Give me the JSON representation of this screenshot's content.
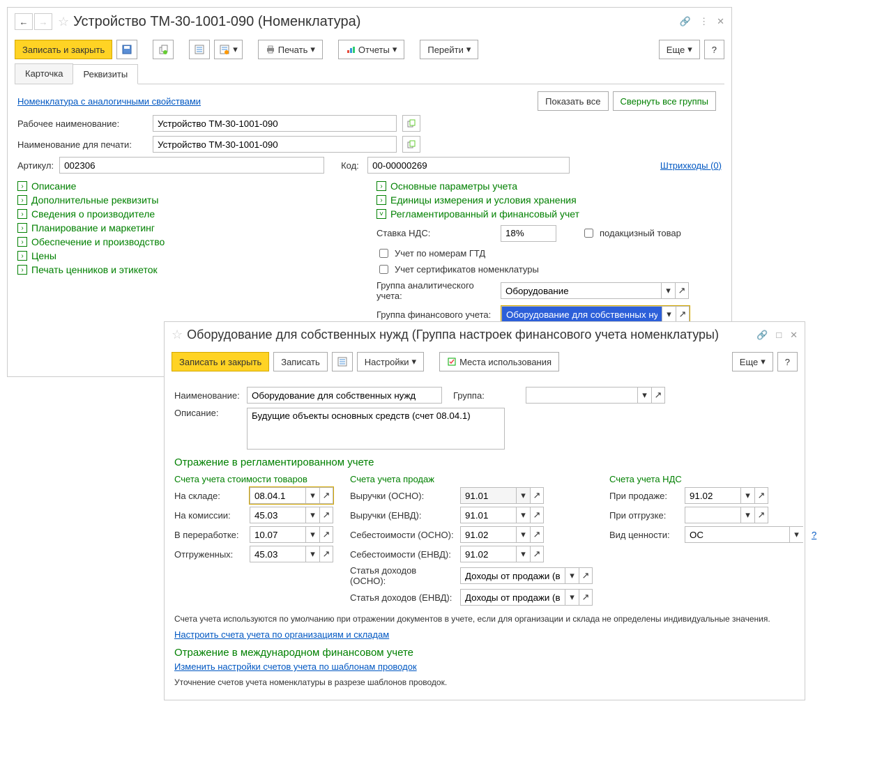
{
  "win1": {
    "title": "Устройство ТМ-30-1001-090 (Номенклатура)",
    "toolbar": {
      "saveAndClose": "Записать и закрыть",
      "print": "Печать",
      "reports": "Отчеты",
      "goto": "Перейти",
      "more": "Еще",
      "help": "?"
    },
    "tabs": {
      "card": "Карточка",
      "details": "Реквизиты"
    },
    "linkSimilar": "Номенклатура с аналогичными свойствами",
    "showAll": "Показать все",
    "collapseAll": "Свернуть все группы",
    "fields": {
      "workName": {
        "label": "Рабочее наименование:",
        "value": "Устройство ТМ-30-1001-090"
      },
      "printName": {
        "label": "Наименование для печати:",
        "value": "Устройство ТМ-30-1001-090"
      },
      "article": {
        "label": "Артикул:",
        "value": "002306"
      },
      "code": {
        "label": "Код:",
        "value": "00-00000269"
      },
      "barcodes": "Штрихкоды (0)"
    },
    "expandersLeft": [
      "Описание",
      "Дополнительные реквизиты",
      "Сведения о производителе",
      "Планирование и маркетинг",
      "Обеспечение и производство",
      "Цены",
      "Печать ценников и этикеток"
    ],
    "expandersRight": {
      "main": "Основные параметры учета",
      "units": "Единицы измерения и условия хранения",
      "fin": "Регламентированный и финансовый учет",
      "vatRate": {
        "label": "Ставка НДС:",
        "value": "18%"
      },
      "excise": "подакцизный товар",
      "gtd": "Учет по номерам ГТД",
      "cert": "Учет сертификатов номенклатуры",
      "analyticGroup": {
        "label": "Группа аналитического учета:",
        "value": "Оборудование"
      },
      "finGroup": {
        "label": "Группа финансового учета:",
        "value": "Оборудование для собственных нужд"
      }
    }
  },
  "win2": {
    "title": "Оборудование для собственных нужд (Группа настроек финансового учета номенклатуры)",
    "toolbar": {
      "saveAndClose": "Записать и закрыть",
      "save": "Записать",
      "settings": "Настройки",
      "usage": "Места использования",
      "more": "Еще",
      "help": "?"
    },
    "name": {
      "label": "Наименование:",
      "value": "Оборудование для собственных нужд"
    },
    "group": {
      "label": "Группа:"
    },
    "desc": {
      "label": "Описание:",
      "value": "Будущие объекты основных средств (счет 08.04.1)"
    },
    "section1": "Отражение в регламентированном учете",
    "col1title": "Счета учета стоимости товаров",
    "col2title": "Счета учета продаж",
    "col3title": "Счета учета НДС",
    "c1": {
      "r1l": "На складе:",
      "r1v": "08.04.1",
      "r2l": "На комиссии:",
      "r2v": "45.03",
      "r3l": "В переработке:",
      "r3v": "10.07",
      "r4l": "Отгруженных:",
      "r4v": "45.03"
    },
    "c2": {
      "r1l": "Выручки (ОСНО):",
      "r1v": "91.01",
      "r2l": "Выручки (ЕНВД):",
      "r2v": "91.01",
      "r3l": "Себестоимости (ОСНО):",
      "r3v": "91.02",
      "r4l": "Себестоимости (ЕНВД):",
      "r4v": "91.02",
      "r5l": "Статья доходов (ОСНО):",
      "r5v": "Доходы от продажи (выб",
      "r6l": "Статья доходов (ЕНВД):",
      "r6v": "Доходы от продажи (выб"
    },
    "c3": {
      "r1l": "При продаже:",
      "r1v": "91.02",
      "r2l": "При отгрузке:",
      "r2v": "",
      "r3l": "Вид ценности:",
      "r3v": "ОС"
    },
    "hint1": "Счета учета используются по умолчанию при отражении документов в учете, если для организации и склада не определены индивидуальные значения.",
    "link1": "Настроить счета учета по организациям и складам",
    "section2": "Отражение в международном финансовом учете",
    "link2": "Изменить настройки счетов учета по шаблонам проводок",
    "hint2": "Уточнение счетов учета номенклатуры в разрезе шаблонов проводок."
  }
}
